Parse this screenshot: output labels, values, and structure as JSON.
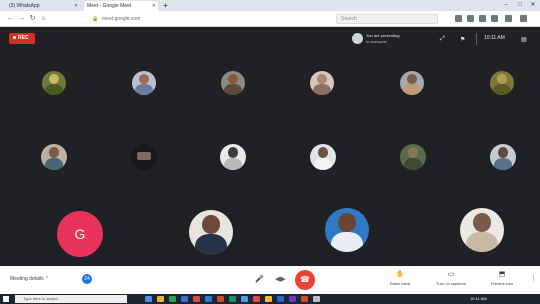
{
  "browser": {
    "tabs": [
      {
        "title": "(3) WhatsApp"
      },
      {
        "title": "Meet - Google Meet"
      }
    ],
    "new_tab": "+",
    "url": "meet.google.com",
    "search_placeholder": "Search"
  },
  "meet": {
    "rec_label": "REC",
    "presenter_name": "You are presenting",
    "presenter_sub": "to everyone",
    "time": "10:11 AM",
    "avatar_letter": "G",
    "meeting_details_label": "Meeting details",
    "people_count": "24",
    "bottom_buttons": [
      {
        "label": "Raise hand",
        "icon": "hand-icon"
      },
      {
        "label": "Turn on captions",
        "icon": "captions-icon"
      },
      {
        "label": "Present now",
        "icon": "present-icon"
      }
    ],
    "colors": {
      "end_call": "#ea4335",
      "rec": "#d93025",
      "avatar_g": "#e8345a",
      "background": "#202124"
    }
  },
  "taskbar": {
    "search_placeholder": "Type here to search",
    "time": "10:11 AM"
  }
}
